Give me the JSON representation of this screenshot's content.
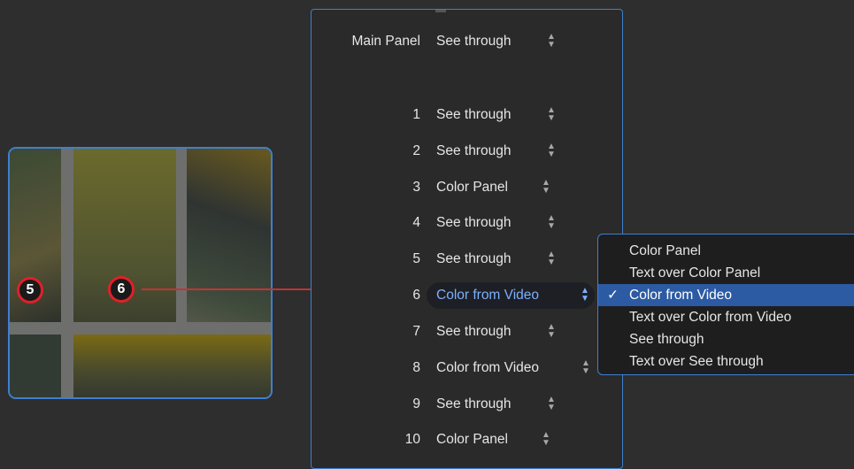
{
  "preview": {
    "markers": [
      {
        "label": "5"
      },
      {
        "label": "6"
      }
    ]
  },
  "inspector": {
    "main_panel": {
      "label": "Main Panel",
      "value": "See through"
    },
    "rows": [
      {
        "label": "1",
        "value": "See through"
      },
      {
        "label": "2",
        "value": "See through"
      },
      {
        "label": "3",
        "value": "Color Panel"
      },
      {
        "label": "4",
        "value": "See through"
      },
      {
        "label": "5",
        "value": "See through"
      },
      {
        "label": "6",
        "value": "Color from Video"
      },
      {
        "label": "7",
        "value": "See through"
      },
      {
        "label": "8",
        "value": "Color from Video"
      },
      {
        "label": "9",
        "value": "See through"
      },
      {
        "label": "10",
        "value": "Color Panel"
      }
    ]
  },
  "dropdown": {
    "check_mark": "✓",
    "options": [
      "Color Panel",
      "Text over Color Panel",
      "Color from Video",
      "Text over Color from Video",
      "See through",
      "Text over See through"
    ],
    "selected_index": 2
  },
  "colors": {
    "accent": "#3f7fd0",
    "marker_ring": "#e02028",
    "connector": "#c23434",
    "selection": "#2c5aa3"
  }
}
